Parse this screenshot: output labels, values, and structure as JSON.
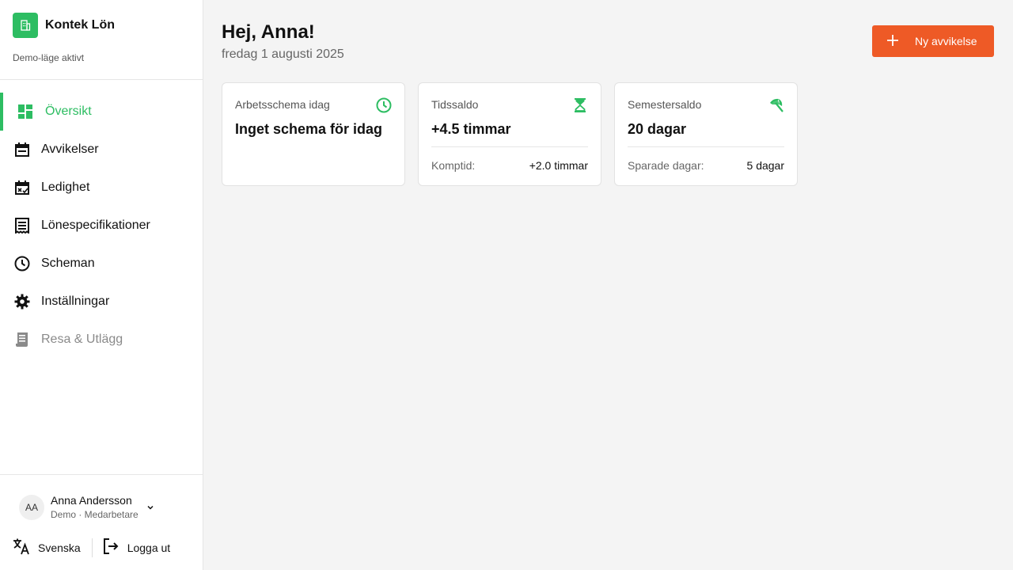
{
  "app": {
    "name": "Kontek Lön",
    "demo_note": "Demo-läge aktivt",
    "brand_color": "#2dbd62",
    "accent_color": "#ee5a26"
  },
  "sidebar": {
    "items": [
      {
        "label": "Översikt",
        "icon": "dashboard-icon",
        "active": true
      },
      {
        "label": "Avvikelser",
        "icon": "calendar-event-icon"
      },
      {
        "label": "Ledighet",
        "icon": "calendar-check-icon"
      },
      {
        "label": "Lönespecifikationer",
        "icon": "receipt-icon"
      },
      {
        "label": "Scheman",
        "icon": "clock-icon"
      },
      {
        "label": "Inställningar",
        "icon": "gear-icon"
      },
      {
        "label": "Resa & Utlägg",
        "icon": "document-icon",
        "disabled": true
      }
    ],
    "user": {
      "initials": "AA",
      "name": "Anna Andersson",
      "role": "Demo · Medarbetare"
    },
    "language_label": "Svenska",
    "logout_label": "Logga ut"
  },
  "main": {
    "greeting": "Hej, Anna!",
    "date": "fredag 1 augusti 2025",
    "new_button_label": "Ny avvikelse",
    "cards": [
      {
        "label": "Arbetsschema idag",
        "icon": "clock-icon",
        "value": "Inget schema för idag"
      },
      {
        "label": "Tidssaldo",
        "icon": "hourglass-icon",
        "value": "+4.5 timmar",
        "sub_key": "Komptid:",
        "sub_value": "+2.0 timmar"
      },
      {
        "label": "Semestersaldo",
        "icon": "beach-umbrella-icon",
        "value": "20 dagar",
        "sub_key": "Sparade dagar:",
        "sub_value": "5 dagar"
      }
    ]
  }
}
